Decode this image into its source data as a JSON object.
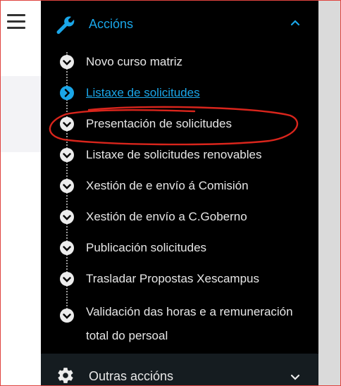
{
  "header": {
    "title": "Accións",
    "icon": "wrench-icon",
    "accent": "#1aa6e8"
  },
  "menu": [
    {
      "label": "Novo curso matriz",
      "active": false
    },
    {
      "label": "Listaxe de solicitudes",
      "active": true
    },
    {
      "label": "Presentación de solicitudes",
      "active": false
    },
    {
      "label": "Listaxe de solicitudes renovables",
      "active": false
    },
    {
      "label": "Xestión de e envío á Comisión",
      "active": false
    },
    {
      "label": "Xestión de envío a C.Goberno",
      "active": false
    },
    {
      "label": "Publicación solicitudes",
      "active": false
    },
    {
      "label": "Trasladar Propostas Xescampus",
      "active": false
    },
    {
      "label": "Validación das horas e a remuneración total do persoal",
      "active": false
    }
  ],
  "footer": {
    "title": "Outras accións",
    "icon": "gear-icon"
  },
  "annotation_color": "#d9251c"
}
